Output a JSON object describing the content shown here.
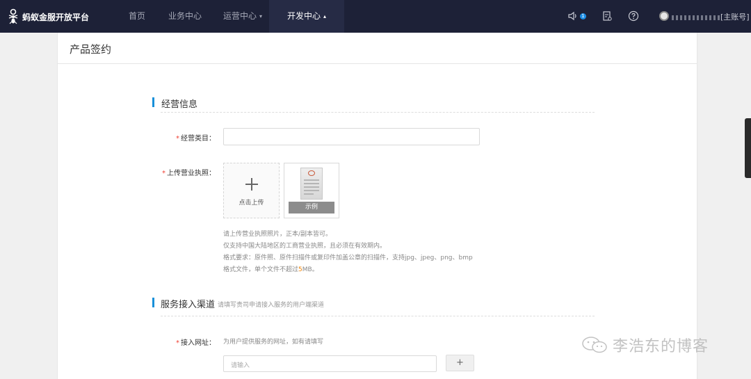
{
  "brand": {
    "name": "蚂蚁金服开放平台"
  },
  "nav": {
    "home": "首页",
    "business": "业务中心",
    "operations": "运营中心",
    "developer": "开发中心",
    "operations_caret": "▾",
    "developer_caret": "▴"
  },
  "header_icons": [
    "speaker-icon",
    "document-icon",
    "help-icon"
  ],
  "notification_count": "1",
  "account": {
    "role": "[主账号]"
  },
  "page": {
    "title": "产品签约"
  },
  "section_business": {
    "title": "经营信息"
  },
  "field_category": {
    "label": "经营类目：",
    "required": "*"
  },
  "field_license": {
    "label": "上传营业执照：",
    "required": "*"
  },
  "upload": {
    "label": "点击上传",
    "sample_label": "示例"
  },
  "license_help": {
    "line1": "请上传营业执照照片，正本/副本皆可。",
    "line2": "仅支持中国大陆地区的工商营业执照，且必须在有效期内。",
    "line3": "格式要求：原件照、原件扫描件或复印件加盖公章的扫描件，支持jpg、jpeg、png、bmp",
    "line4_pre": "格式文件，单个文件不超过",
    "line4_num": "5",
    "line4_post": "MB。"
  },
  "section_channel": {
    "title": "服务接入渠道",
    "hint": "请填写贵司申请接入服务的用户端渠道"
  },
  "field_url": {
    "label": "接入网址：",
    "required": "*",
    "hint": "为用户提供服务的网址，如有请填写",
    "placeholder": "请输入",
    "add_label": "+"
  },
  "watermark": {
    "text": "李浩东的博客"
  },
  "colors": {
    "nav_bg": "#1d2137",
    "accent": "#1890d9",
    "required": "#f04134",
    "highlight": "#f08200"
  }
}
